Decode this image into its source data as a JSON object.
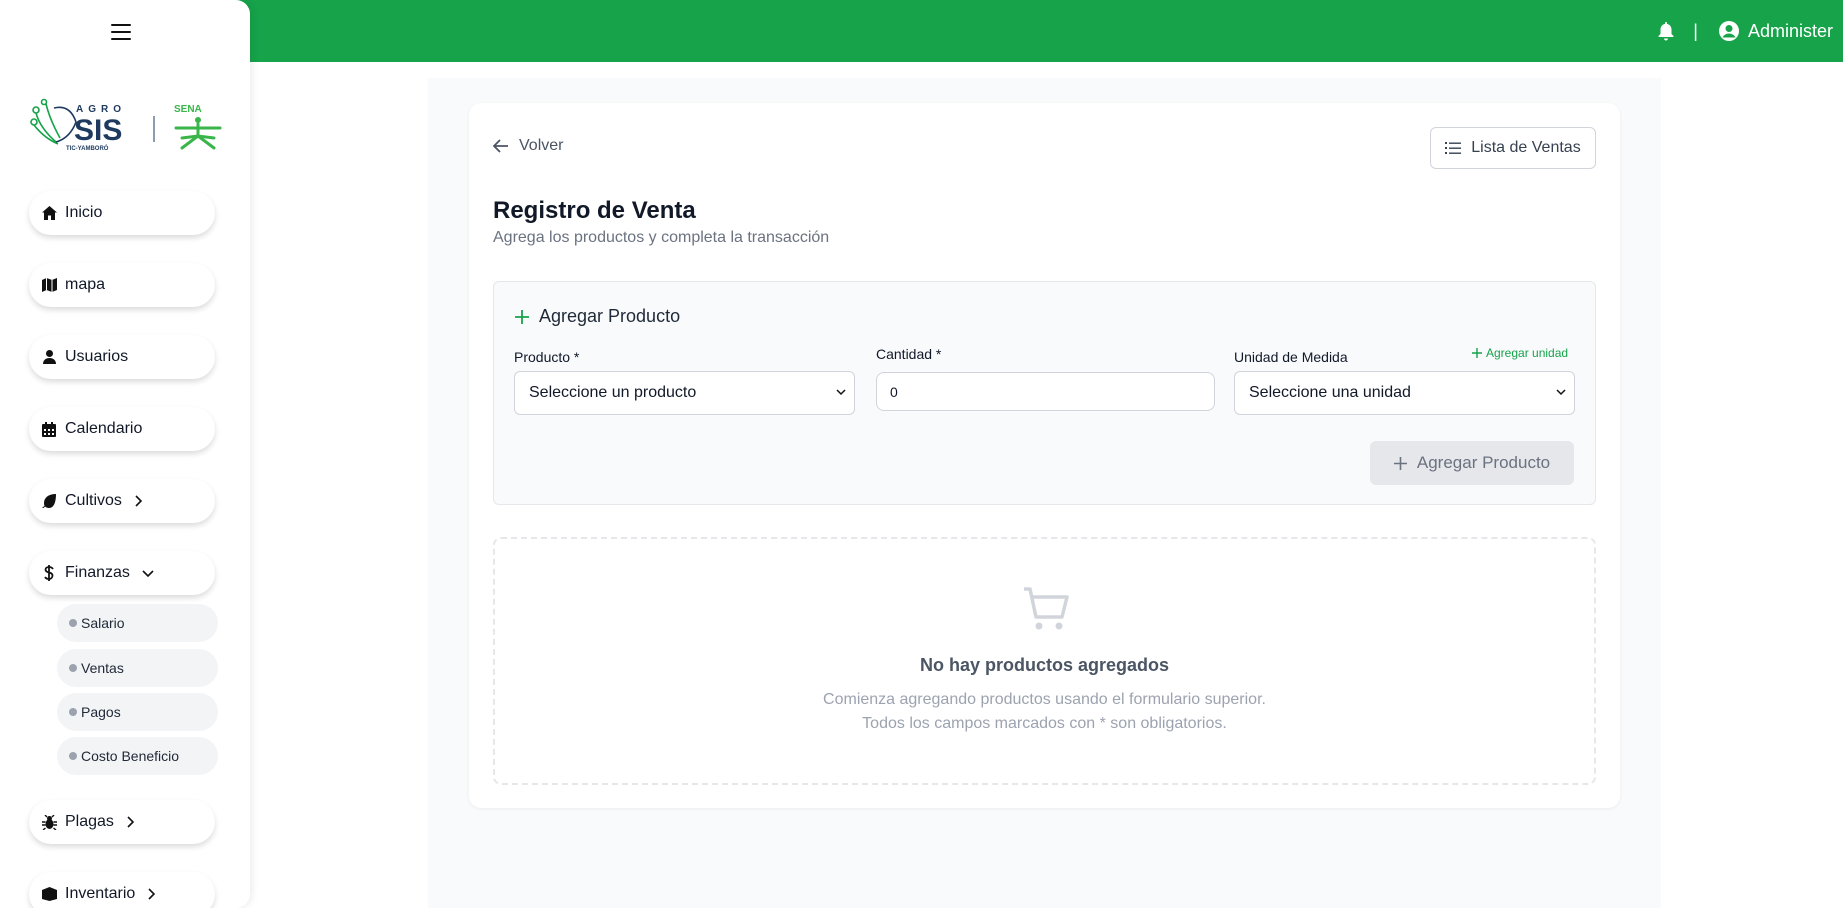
{
  "header": {
    "user_name": "Administer",
    "separator": "|"
  },
  "sidebar": {
    "logo_text": "AGRO SIS",
    "logo_sub": "TIC-YAMBORÓ",
    "partner_logo": "SENA",
    "items": [
      {
        "label": "Inicio",
        "icon": "home-icon"
      },
      {
        "label": "mapa",
        "icon": "map-icon"
      },
      {
        "label": "Usuarios",
        "icon": "user-icon"
      },
      {
        "label": "Calendario",
        "icon": "calendar-icon"
      },
      {
        "label": "Cultivos",
        "icon": "leaf-icon"
      },
      {
        "label": "Finanzas",
        "icon": "dollar-icon"
      },
      {
        "label": "Plagas",
        "icon": "bug-icon"
      },
      {
        "label": "Inventario",
        "icon": "box-icon"
      }
    ],
    "finanzas_sub": [
      "Salario",
      "Ventas",
      "Pagos",
      "Costo Beneficio"
    ]
  },
  "main": {
    "back_label": "Volver",
    "list_button_label": "Lista de Ventas",
    "title": "Registro de Venta",
    "subtitle": "Agrega los productos y completa la transacción",
    "form": {
      "heading": "Agregar Producto",
      "producto_label": "Producto *",
      "producto_value": "Seleccione un producto",
      "cantidad_label": "Cantidad *",
      "cantidad_value": "0",
      "unidad_label": "Unidad de Medida",
      "add_unit_label": "Agregar unidad",
      "unidad_value": "Seleccione una unidad",
      "submit_label": "Agregar Producto"
    },
    "empty": {
      "title": "No hay productos agregados",
      "line1": "Comienza agregando productos usando el formulario superior.",
      "line2": "Todos los campos marcados con * son obligatorios."
    }
  },
  "colors": {
    "brand": "#16a34a",
    "background": "#f9fafb",
    "muted": "#6b7280"
  }
}
